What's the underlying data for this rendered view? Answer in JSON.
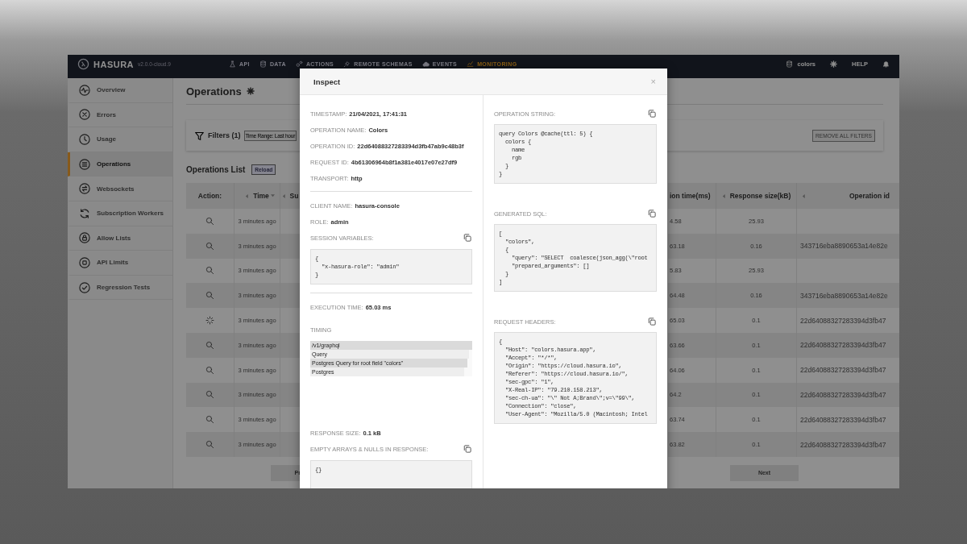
{
  "navbar": {
    "brand": "HASURA",
    "version": "v2.0.0-cloud.9",
    "tabs": [
      {
        "label": "API",
        "selected": false
      },
      {
        "label": "DATA",
        "selected": false
      },
      {
        "label": "ACTIONS",
        "selected": false
      },
      {
        "label": "REMOTE SCHEMAS",
        "selected": false
      },
      {
        "label": "EVENTS",
        "selected": false
      },
      {
        "label": "MONITORING",
        "selected": true
      }
    ],
    "project": "colors",
    "help": "HELP"
  },
  "sidebar": {
    "items": [
      {
        "label": "Overview",
        "selected": false
      },
      {
        "label": "Errors",
        "selected": false
      },
      {
        "label": "Usage",
        "selected": false
      },
      {
        "label": "Operations",
        "selected": true
      },
      {
        "label": "Websockets",
        "selected": false
      },
      {
        "label": "Subscription Workers",
        "selected": false
      },
      {
        "label": "Allow Lists",
        "selected": false
      },
      {
        "label": "API Limits",
        "selected": false
      },
      {
        "label": "Regression Tests",
        "selected": false
      }
    ]
  },
  "page": {
    "title": "Operations",
    "filters": {
      "label": "Filters (1)",
      "chips": [
        "Time Range: Last hour"
      ],
      "remove_all": "REMOVE ALL FILTERS"
    },
    "list_title": "Operations List",
    "reload": "Reload",
    "table": {
      "columns": [
        {
          "label": "Action:",
          "sort": false,
          "menu": false
        },
        {
          "label": "Time",
          "sort": true,
          "menu": true
        },
        {
          "label": "Su",
          "sort": true,
          "menu": false
        },
        {
          "label": "ion time(ms)",
          "sort": false,
          "menu": false
        },
        {
          "label": "Response size(kB)",
          "sort": true,
          "menu": false
        },
        {
          "label": "Operation id",
          "sort": true,
          "menu": false
        }
      ],
      "rows": [
        {
          "kind": "search",
          "time": "3 minutes ago",
          "execution_time": "4.58",
          "response_size": "25.93"
        },
        {
          "kind": "search",
          "time": "3 minutes ago",
          "execution_time": "63.18",
          "response_size": "0.16",
          "operation_id": "343716eba8890653a14e82e"
        },
        {
          "kind": "search",
          "time": "3 minutes ago",
          "execution_time": "5.83",
          "response_size": "25.93"
        },
        {
          "kind": "search",
          "time": "3 minutes ago",
          "execution_time": "64.48",
          "response_size": "0.16",
          "operation_id": "343716eba8890653a14e82e"
        },
        {
          "kind": "spinner",
          "time": "3 minutes ago",
          "execution_time": "65.03",
          "response_size": "0.1",
          "operation_id": "22d64088327283394d3fb47"
        },
        {
          "kind": "search",
          "time": "3 minutes ago",
          "execution_time": "63.66",
          "response_size": "0.1",
          "operation_id": "22d64088327283394d3fb47"
        },
        {
          "kind": "search",
          "time": "3 minutes ago",
          "execution_time": "64.06",
          "response_size": "0.1",
          "operation_id": "22d64088327283394d3fb47"
        },
        {
          "kind": "search",
          "time": "3 minutes ago",
          "execution_time": "64.2",
          "response_size": "0.1",
          "operation_id": "22d64088327283394d3fb47"
        },
        {
          "kind": "search",
          "time": "3 minutes ago",
          "execution_time": "63.74",
          "response_size": "0.1",
          "operation_id": "22d64088327283394d3fb47"
        },
        {
          "kind": "search",
          "time": "3 minutes ago",
          "execution_time": "63.82",
          "response_size": "0.1",
          "operation_id": "22d64088327283394d3fb47"
        }
      ]
    },
    "pagination": {
      "previous": "Pr",
      "next": "Next"
    }
  },
  "modal": {
    "title": "Inspect",
    "close": "×",
    "left": [
      {
        "kind": "field",
        "label": "TIMESTAMP:",
        "value": "21/04/2021, 17:41:31"
      },
      {
        "kind": "field",
        "label": "OPERATION NAME:",
        "value": "Colors"
      },
      {
        "kind": "field",
        "label": "OPERATION ID:",
        "value": "22d64088327283394d3fb47ab9c48b3f"
      },
      {
        "kind": "field",
        "label": "REQUEST ID:",
        "value": "4b61306964b8f1a381e4017e07e27df9"
      },
      {
        "kind": "field",
        "label": "TRANSPORT:",
        "value": "http"
      },
      {
        "kind": "divider"
      },
      {
        "kind": "field",
        "label": "CLIENT NAME:",
        "value": "hasura-console"
      },
      {
        "kind": "field",
        "label": "ROLE:",
        "value": "admin"
      },
      {
        "kind": "code",
        "label": "SESSION VARIABLES:",
        "lines": [
          "{",
          "  \"x-hasura-role\": \"admin\"",
          "}"
        ]
      },
      {
        "kind": "divider"
      },
      {
        "kind": "field",
        "label": "EXECUTION TIME:",
        "value": "65.03 ms"
      },
      {
        "kind": "timing",
        "label": "TIMING",
        "bars": [
          {
            "label": "/v1/graphql",
            "level": 1
          },
          {
            "label": "Query",
            "level": 0.98
          },
          {
            "label": "Postgres Query for root field \"colors\"",
            "level": 0.97
          },
          {
            "label": "Postgres",
            "level": 0.95
          }
        ]
      },
      {
        "kind": "field",
        "label": "RESPONSE SIZE:",
        "value": "0.1 kB"
      },
      {
        "kind": "code",
        "label": "EMPTY ARRAYS & NULLS IN RESPONSE:",
        "lines": [
          "{}"
        ]
      }
    ],
    "right": [
      {
        "kind": "code",
        "label": "OPERATION STRING:",
        "lines": [
          "query Colors @cache(ttl: 5) {",
          "  colors {",
          "    name",
          "    rgb",
          "  }",
          "}"
        ]
      },
      {
        "kind": "code",
        "label": "GENERATED SQL:",
        "lines": [
          "[",
          "  \"colors\",",
          "  {",
          "    \"query\": \"SELECT  coalesce(json_agg(\\\"root",
          "    \"prepared_arguments\": []",
          "  }",
          "]"
        ]
      },
      {
        "kind": "code",
        "label": "REQUEST HEADERS:",
        "lines": [
          "{",
          "  \"Host\": \"colors.hasura.app\",",
          "  \"Accept\": \"*/*\",",
          "  \"Origin\": \"https://cloud.hasura.io\",",
          "  \"Referer\": \"https://cloud.hasura.io/\",",
          "  \"sec-gpc\": \"1\",",
          "  \"X-Real-IP\": \"79.210.158.213\",",
          "  \"sec-ch-ua\": \"\\\" Not A;Brand\\\";v=\\\"99\\\",",
          "  \"Connection\": \"close\",",
          "  \"User-Agent\": \"Mozilla/5.0 (Macintosh; Intel"
        ]
      }
    ]
  }
}
